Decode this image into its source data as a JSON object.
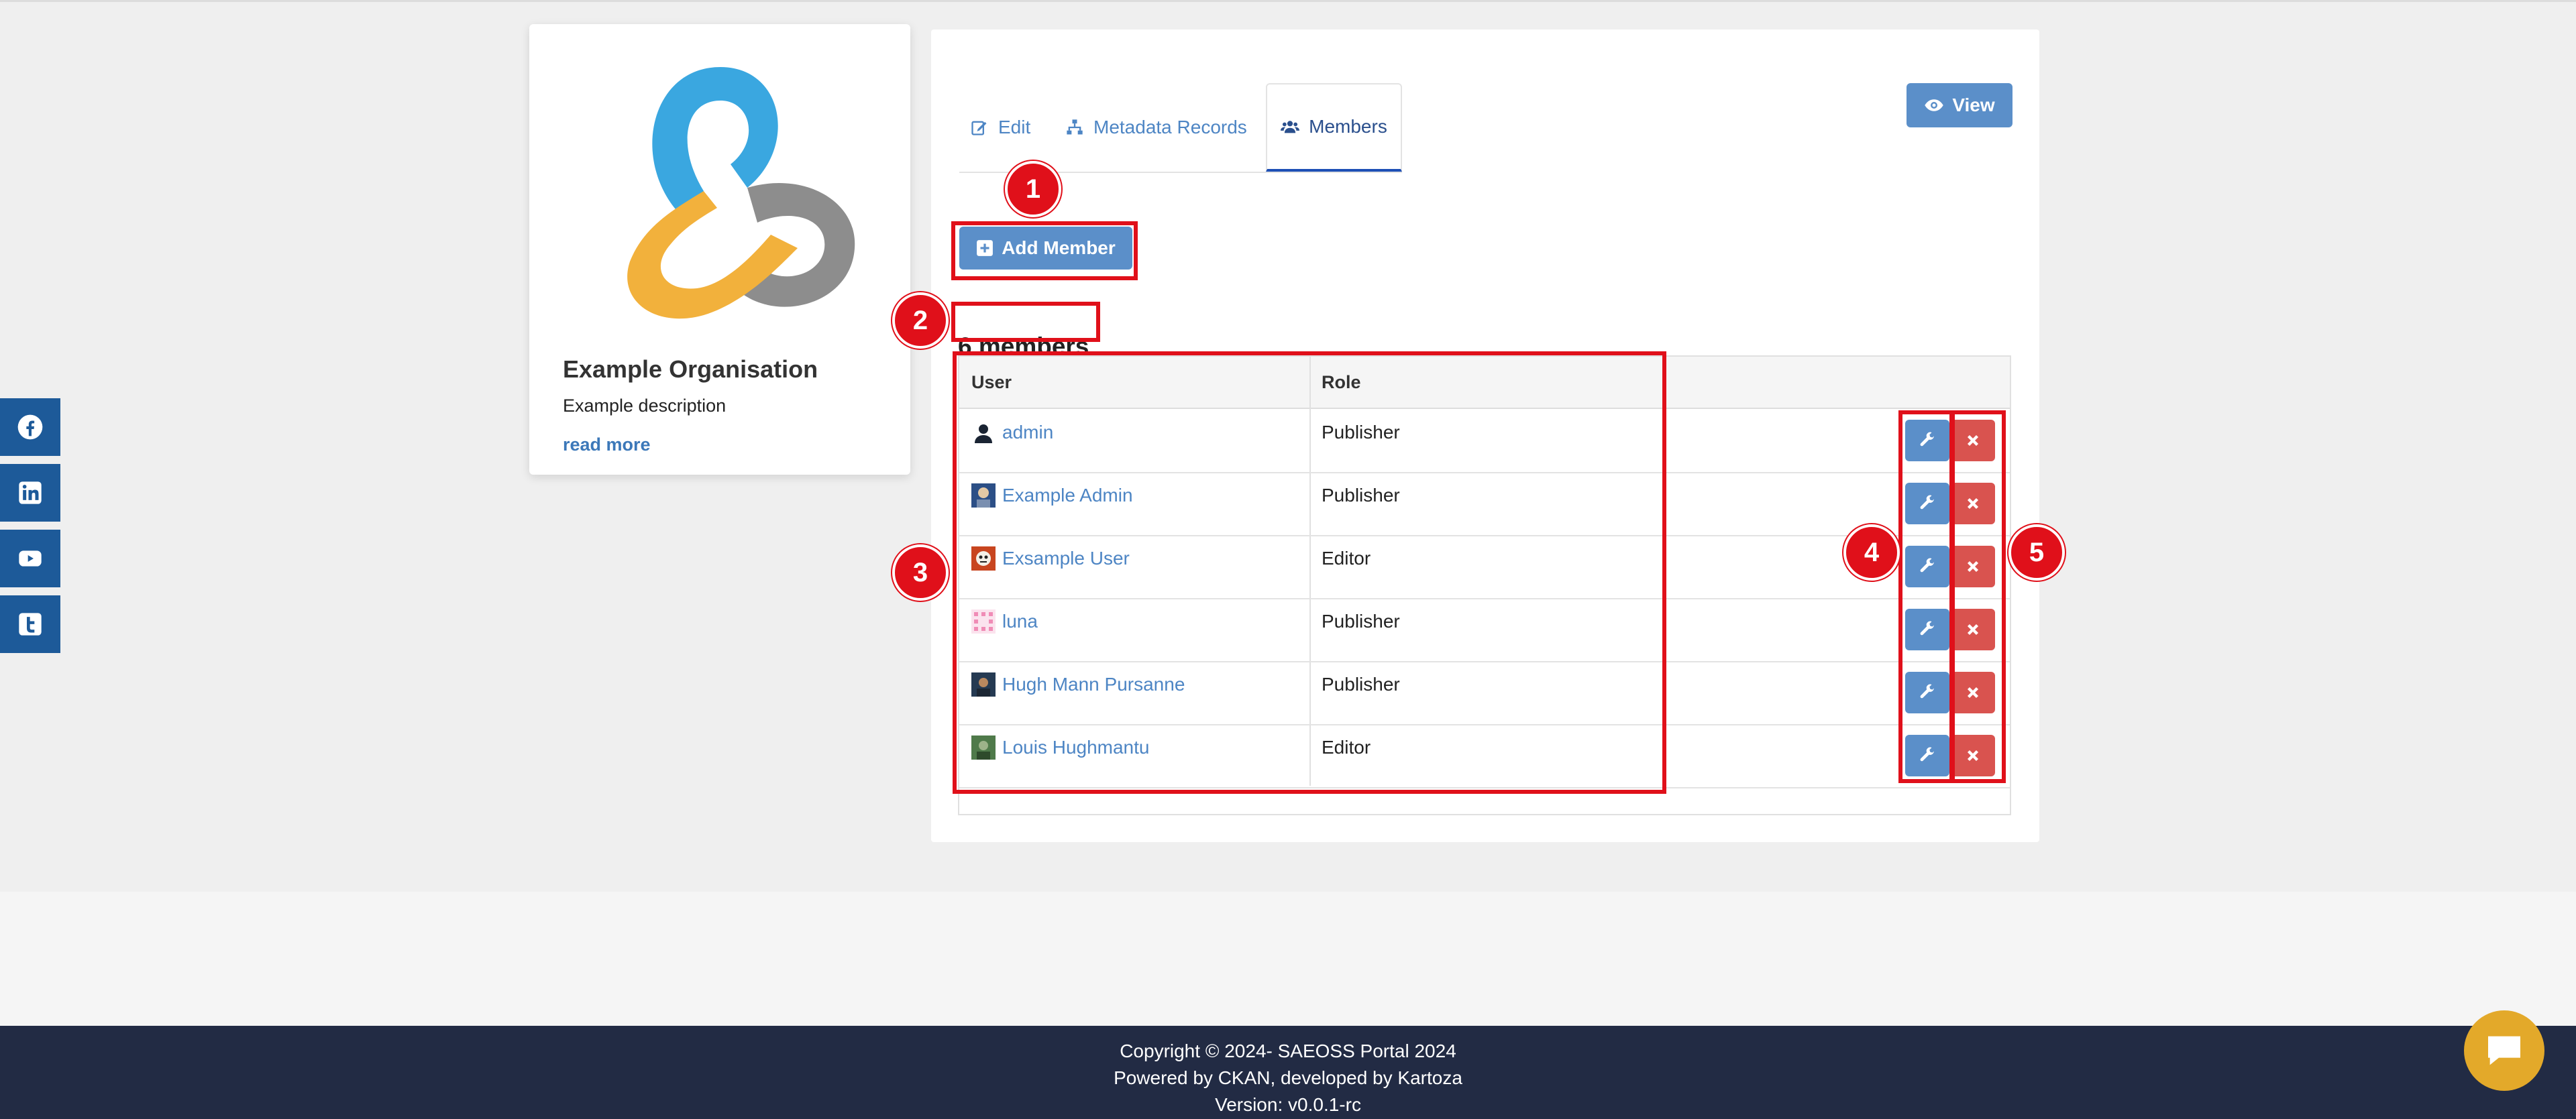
{
  "social": [
    {
      "icon": "facebook-icon",
      "label": "Facebook"
    },
    {
      "icon": "linkedin-icon",
      "label": "LinkedIn"
    },
    {
      "icon": "youtube-icon",
      "label": "YouTube"
    },
    {
      "icon": "twitter-icon",
      "label": "Twitter"
    }
  ],
  "org": {
    "name": "Example Organisation",
    "description": "Example description",
    "read_more": "read more"
  },
  "tabs": {
    "edit": "Edit",
    "metadata": "Metadata Records",
    "members": "Members"
  },
  "view_label": "View",
  "add_member_label": "Add Member",
  "member_count": "6 members",
  "table": {
    "headers": [
      "User",
      "Role"
    ],
    "rows": [
      {
        "user": "admin",
        "role": "Publisher"
      },
      {
        "user": "Example Admin",
        "role": "Publisher"
      },
      {
        "user": "Exsample User",
        "role": "Editor"
      },
      {
        "user": "luna",
        "role": "Publisher"
      },
      {
        "user": "Hugh Mann Pursanne",
        "role": "Publisher"
      },
      {
        "user": "Louis Hughmantu",
        "role": "Editor"
      }
    ]
  },
  "annotations": [
    "1",
    "2",
    "3",
    "4",
    "5"
  ],
  "footer": {
    "copyright": "Copyright © 2024- SAEOSS Portal 2024",
    "powered": "Powered by CKAN, developed by Kartoza",
    "version": "Version: v0.0.1-rc"
  },
  "colors": {
    "primary": "#5b8fc9",
    "danger": "#d9534f",
    "social": "#1d5a99",
    "footer": "#222b44",
    "annotation": "#e0101a",
    "chat": "#e3a92a"
  }
}
